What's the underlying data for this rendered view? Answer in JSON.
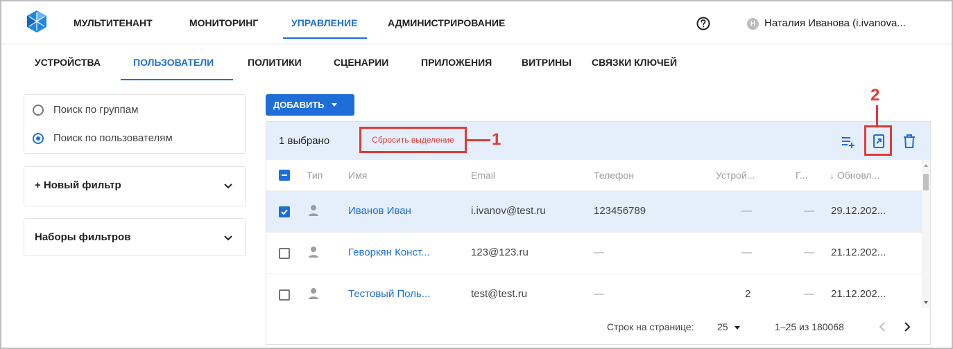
{
  "colors": {
    "accent": "#1e6dd8",
    "annotation": "#e53935",
    "selected_row": "#e5effb"
  },
  "topnav": {
    "items": [
      "МУЛЬТИТЕНАНТ",
      "МОНИТОРИНГ",
      "УПРАВЛЕНИЕ",
      "АДМИНИСТРИРОВАНИЕ"
    ],
    "active": "УПРАВЛЕНИЕ",
    "help_icon": "question-circle-icon",
    "avatar_letter": "Н",
    "user": "Наталия Иванова (i.ivanova..."
  },
  "subnav": {
    "items": [
      "УСТРОЙСТВА",
      "ПОЛЬЗОВАТЕЛИ",
      "ПОЛИТИКИ",
      "СЦЕНАРИИ",
      "ПРИЛОЖЕНИЯ",
      "ВИТРИНЫ",
      "СВЯЗКИ КЛЮЧЕЙ"
    ],
    "active": "ПОЛЬЗОВАТЕЛИ"
  },
  "search_mode": {
    "options": [
      "Поиск по группам",
      "Поиск по пользователям"
    ],
    "selected": "Поиск по пользователям"
  },
  "filters": {
    "new_filter": "+ Новый фильтр",
    "filter_sets": "Наборы фильтров"
  },
  "actions": {
    "add_label": "ДОБАВИТЬ"
  },
  "selection_bar": {
    "count_label": "1 выбрано",
    "reset_label": "Сбросить выделение",
    "icons": [
      "add-to-list-icon",
      "export-icon",
      "delete-icon"
    ]
  },
  "annotations": {
    "marker_1": "1",
    "marker_2": "2"
  },
  "table": {
    "columns": [
      "Тип",
      "Имя",
      "Email",
      "Телефон",
      "Устрой...",
      "Г...",
      "↓ Обновл..."
    ],
    "rows": [
      {
        "selected": true,
        "name": "Иванов Иван",
        "email": "i.ivanov@test.ru",
        "phone": "123456789",
        "devices": "—",
        "groups": "—",
        "updated": "29.12.202..."
      },
      {
        "selected": false,
        "name": "Геворкян Конст...",
        "email": "123@123.ru",
        "phone": "—",
        "devices": "—",
        "groups": "—",
        "updated": "21.12.202..."
      },
      {
        "selected": false,
        "name": "Тестовый Поль...",
        "email": "test@test.ru",
        "phone": "—",
        "devices": "2",
        "groups": "—",
        "updated": "21.12.202..."
      }
    ]
  },
  "pagination": {
    "rows_per_page_label": "Строк на странице:",
    "rows_per_page": "25",
    "range": "1–25 из 180068"
  }
}
